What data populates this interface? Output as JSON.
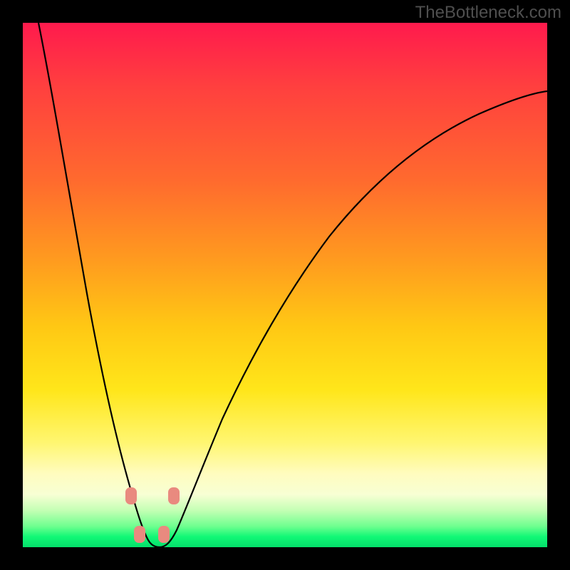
{
  "watermark": "TheBottleneck.com",
  "chart_data": {
    "type": "line",
    "title": "",
    "xlabel": "",
    "ylabel": "",
    "xlim": [
      0,
      1
    ],
    "ylim": [
      0,
      1
    ],
    "note": "Axis ticks and labels are not rendered in the screenshot; values below are read off relative to the plot area (0–1 on each axis, origin at bottom-left). The black curve is a V-shaped dip reaching y≈0 near x≈0.24, rising steeply on the left and more gradually on the right. Four rounded salmon markers sit around the dip bottom.",
    "series": [
      {
        "name": "curve",
        "x": [
          0.03,
          0.06,
          0.09,
          0.12,
          0.15,
          0.18,
          0.2,
          0.22,
          0.24,
          0.26,
          0.28,
          0.31,
          0.35,
          0.4,
          0.46,
          0.54,
          0.63,
          0.72,
          0.82,
          0.92,
          1.0
        ],
        "y": [
          1.0,
          0.84,
          0.66,
          0.48,
          0.31,
          0.16,
          0.08,
          0.02,
          0.0,
          0.02,
          0.06,
          0.14,
          0.24,
          0.36,
          0.47,
          0.58,
          0.67,
          0.74,
          0.79,
          0.82,
          0.84
        ]
      }
    ],
    "markers": [
      {
        "name": "marker-left-upper",
        "x": 0.205,
        "y": 0.095
      },
      {
        "name": "marker-left-lower",
        "x": 0.22,
        "y": 0.02
      },
      {
        "name": "marker-right-lower",
        "x": 0.265,
        "y": 0.02
      },
      {
        "name": "marker-right-upper",
        "x": 0.285,
        "y": 0.095
      }
    ],
    "gradient_stops": [
      {
        "pos": 0.0,
        "color": "#ff1a4d"
      },
      {
        "pos": 0.3,
        "color": "#ff6a2e"
      },
      {
        "pos": 0.58,
        "color": "#ffc814"
      },
      {
        "pos": 0.8,
        "color": "#fff670"
      },
      {
        "pos": 0.93,
        "color": "#c3ffb4"
      },
      {
        "pos": 1.0,
        "color": "#04e06b"
      }
    ]
  }
}
